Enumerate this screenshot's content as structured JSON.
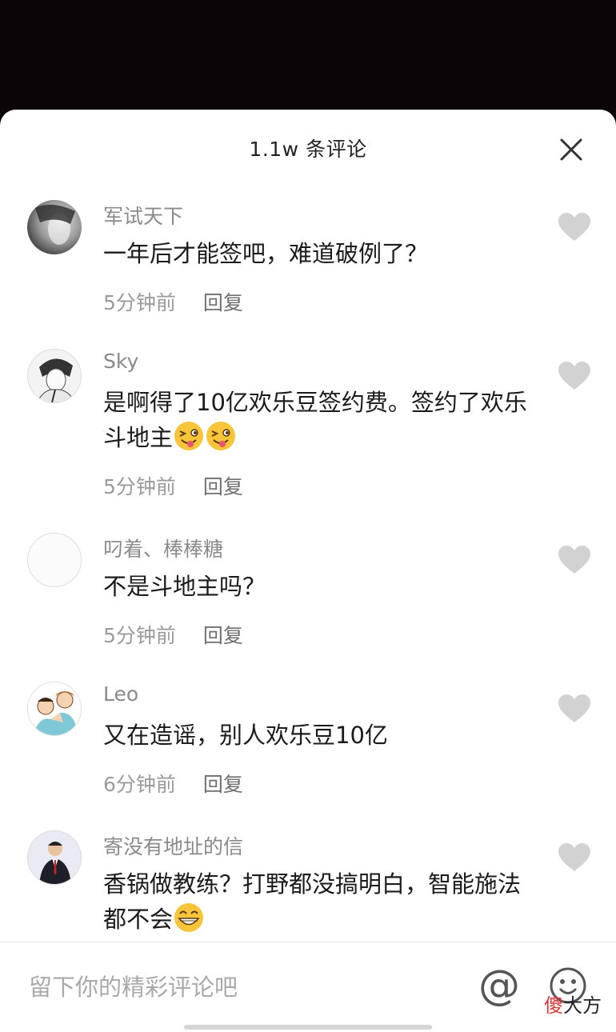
{
  "header": {
    "title": "1.1w 条评论"
  },
  "comments": [
    {
      "name": "军试天下",
      "text": "一年后才能签吧，难道破例了？",
      "text_after_emoji": "",
      "time": "5分钟前",
      "reply": "回复"
    },
    {
      "name": "Sky",
      "text": "是啊得了10亿欢乐豆签约费。签约了欢乐斗地主",
      "text_after_emoji": "",
      "time": "5分钟前",
      "reply": "回复"
    },
    {
      "name": "叼着、棒棒糖",
      "text": "不是斗地主吗？",
      "text_after_emoji": "",
      "time": "5分钟前",
      "reply": "回复"
    },
    {
      "name": "Leo",
      "text": "又在造谣，别人欢乐豆10亿",
      "text_after_emoji": "",
      "time": "6分钟前",
      "reply": "回复"
    },
    {
      "name": "寄没有地址的信",
      "text": "香锅做教练？打野都没搞明白，智能施法都不会",
      "text_after_emoji": "",
      "time": "",
      "reply": ""
    }
  ],
  "composer": {
    "placeholder": "留下你的精彩评论吧",
    "at_symbol": "@"
  },
  "watermark": {
    "part1": "傻",
    "part2": "大方"
  },
  "colors": {
    "sheet": "#ffffff",
    "backdrop": "#0b0508",
    "heart": "#d2d2d2",
    "name": "#8a8a8a"
  },
  "icons": {
    "close": "close-icon",
    "like": "heart-icon",
    "emoji": "emoji-face-icon",
    "mention": "at-icon"
  }
}
